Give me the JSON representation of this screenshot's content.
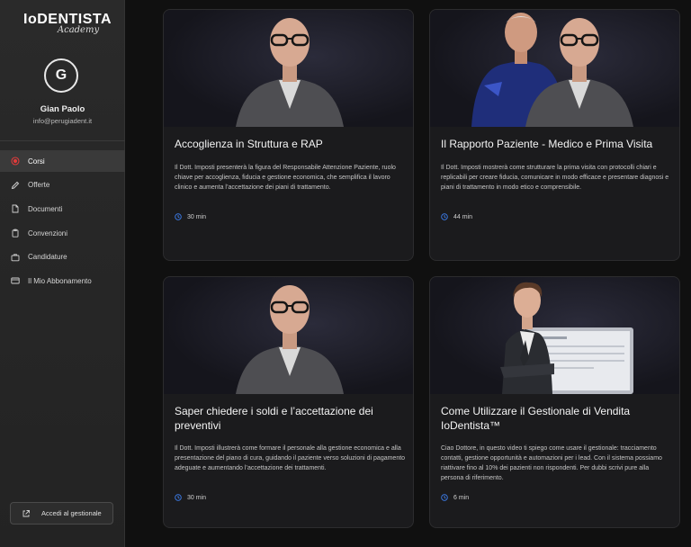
{
  "brand": {
    "logo_main": "IoDENTISTA",
    "logo_sub": "Academy"
  },
  "user": {
    "initial": "G",
    "name": "Gian Paolo",
    "email": "info@perugiadent.it"
  },
  "nav": [
    {
      "label": "Corsi",
      "icon": "target-icon",
      "active": true
    },
    {
      "label": "Offerte",
      "icon": "pencil-icon",
      "active": false
    },
    {
      "label": "Documenti",
      "icon": "document-icon",
      "active": false
    },
    {
      "label": "Convenzioni",
      "icon": "clipboard-icon",
      "active": false
    },
    {
      "label": "Candidature",
      "icon": "briefcase-icon",
      "active": false
    },
    {
      "label": "Il Mio Abbonamento",
      "icon": "card-icon",
      "active": false
    }
  ],
  "external_button": {
    "label": "Accedi al gestionale",
    "icon": "external-link-icon"
  },
  "courses": [
    {
      "title": "Accoglienza in Struttura e RAP",
      "description": "Il Dott. Imposti presenterà la figura del Responsabile Attenzione Paziente, ruolo chiave per accoglienza, fiducia e gestione economica, che semplifica il lavoro clinico e aumenta l’accettazione dei piani di trattamento.",
      "duration": "30 min"
    },
    {
      "title": "Il Rapporto Paziente - Medico e Prima Visita",
      "description": "Il Dott. Imposti mostrerà come strutturare la prima visita con protocolli chiari e replicabili per creare fiducia, comunicare in modo efficace e presentare diagnosi e piani di trattamento in modo etico e comprensibile.",
      "duration": "44 min"
    },
    {
      "title": "Saper chiedere i soldi e l’accettazione dei preventivi",
      "description": "Il Dott. Imposti illustrerà come formare il personale alla gestione economica e alla presentazione del piano di cura, guidando il paziente verso soluzioni di pagamento adeguate e aumentando l’accettazione dei trattamenti.",
      "duration": "30 min"
    },
    {
      "title": "Come Utilizzare il Gestionale di Vendita IoDentista™",
      "description": "Ciao Dottore, in questo video ti spiego come usare il gestionale: tracciamento contatti, gestione opportunità e automazioni per i lead. Con il sistema possiamo riattivare fino al 10% dei pazienti non rispondenti. Per dubbi scrivi pure alla persona di riferimento.",
      "duration": "6 min"
    }
  ],
  "colors": {
    "accent": "#e03b3b",
    "clock": "#3d7ff0",
    "background": "#101010",
    "sidebar": "#2a2a2a"
  }
}
